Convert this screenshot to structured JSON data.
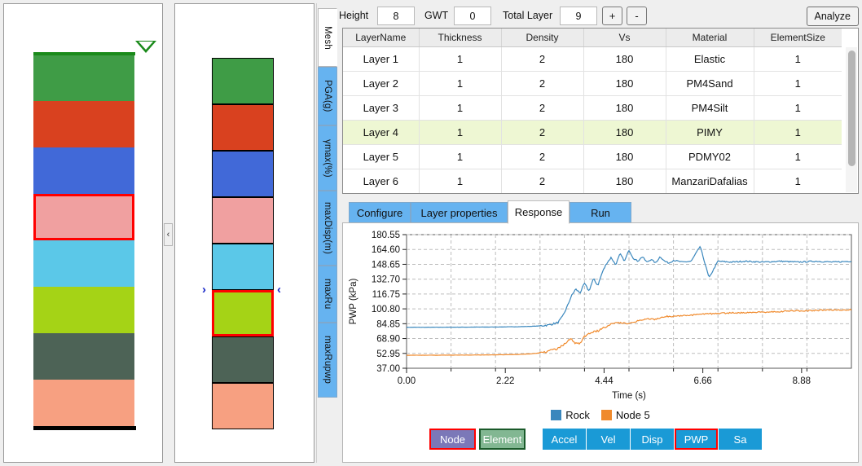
{
  "toolbar": {
    "height_label": "Height",
    "height_value": "8",
    "gwt_label": "GWT",
    "gwt_value": "0",
    "total_layer_label": "Total Layer",
    "total_layer_value": "9",
    "plus_label": "+",
    "minus_label": "-",
    "analyze_label": "Analyze"
  },
  "vertical_tabs": [
    {
      "label": "Mesh",
      "active": true
    },
    {
      "label": "PGA(g)",
      "active": false
    },
    {
      "label": "γmax(%)",
      "active": false
    },
    {
      "label": "maxDisp(m)",
      "active": false
    },
    {
      "label": "maxRu",
      "active": false
    },
    {
      "label": "maxRupwp",
      "active": false
    }
  ],
  "table": {
    "columns": [
      "LayerName",
      "Thickness",
      "Density",
      "Vs",
      "Material",
      "ElementSize"
    ],
    "rows": [
      {
        "cells": [
          "Layer 1",
          "1",
          "2",
          "180",
          "Elastic",
          "1"
        ],
        "selected": false
      },
      {
        "cells": [
          "Layer 2",
          "1",
          "2",
          "180",
          "PM4Sand",
          "1"
        ],
        "selected": false
      },
      {
        "cells": [
          "Layer 3",
          "1",
          "2",
          "180",
          "PM4Silt",
          "1"
        ],
        "selected": false
      },
      {
        "cells": [
          "Layer 4",
          "1",
          "2",
          "180",
          "PIMY",
          "1"
        ],
        "selected": true
      },
      {
        "cells": [
          "Layer 5",
          "1",
          "2",
          "180",
          "PDMY02",
          "1"
        ],
        "selected": false
      },
      {
        "cells": [
          "Layer 6",
          "1",
          "2",
          "180",
          "ManzariDafalias",
          "1"
        ],
        "selected": false
      }
    ]
  },
  "bottom_tabs": [
    {
      "label": "Configure",
      "active": false
    },
    {
      "label": "Layer properties",
      "active": false
    },
    {
      "label": "Response",
      "active": true
    },
    {
      "label": "Run",
      "active": false
    }
  ],
  "selector_buttons": [
    {
      "label": "Node",
      "style": "node"
    },
    {
      "label": "Element",
      "style": "elem"
    }
  ],
  "response_buttons": [
    {
      "label": "Accel",
      "selected": false
    },
    {
      "label": "Vel",
      "selected": false
    },
    {
      "label": "Disp",
      "selected": false
    },
    {
      "label": "PWP",
      "selected": true
    },
    {
      "label": "Sa",
      "selected": false
    }
  ],
  "profile": {
    "water_table_icon": "water-table-triangle",
    "left_layers": [
      {
        "color": "#3f9c46",
        "selected": false
      },
      {
        "color": "#d9411f",
        "selected": false
      },
      {
        "color": "#4169d8",
        "selected": false
      },
      {
        "color": "#f0a0a0",
        "selected": true
      },
      {
        "color": "#5bc8e8",
        "selected": false
      },
      {
        "color": "#a5d316",
        "selected": false
      },
      {
        "color": "#4d6356",
        "selected": false
      },
      {
        "color": "#f7a081",
        "selected": false
      }
    ],
    "mid_layers": [
      {
        "color": "#3f9c46",
        "selected": false
      },
      {
        "color": "#d9411f",
        "selected": false
      },
      {
        "color": "#4169d8",
        "selected": false
      },
      {
        "color": "#f0a0a0",
        "selected": false
      },
      {
        "color": "#5bc8e8",
        "selected": false
      },
      {
        "color": "#a5d316",
        "selected": true
      },
      {
        "color": "#4d6356",
        "selected": false
      },
      {
        "color": "#f7a081",
        "selected": false
      }
    ],
    "collapse_handle_label": "‹",
    "left_marker": "›",
    "right_marker": "‹"
  },
  "chart_data": {
    "type": "line",
    "title": "",
    "xlabel": "Time (s)",
    "ylabel": "PWP (kPa)",
    "xlim": [
      0.0,
      10.0
    ],
    "ylim": [
      37.0,
      180.55
    ],
    "xticks": [
      "0.00",
      "2.22",
      "4.44",
      "6.66",
      "8.88"
    ],
    "xtick_values": [
      0.0,
      2.22,
      4.44,
      6.66,
      8.88
    ],
    "yticks": [
      "37.00",
      "52.95",
      "68.90",
      "84.85",
      "100.80",
      "116.75",
      "132.70",
      "148.65",
      "164.60",
      "180.55"
    ],
    "ytick_values": [
      37.0,
      52.95,
      68.9,
      84.85,
      100.8,
      116.75,
      132.7,
      148.65,
      164.6,
      180.55
    ],
    "grid": true,
    "legend_position": "bottom",
    "series": [
      {
        "name": "Rock",
        "color": "#3a87bd",
        "x": [
          0.0,
          0.5,
          1.0,
          1.5,
          2.0,
          2.5,
          2.8,
          3.0,
          3.2,
          3.4,
          3.5,
          3.6,
          3.7,
          3.8,
          3.9,
          4.0,
          4.1,
          4.2,
          4.3,
          4.4,
          4.5,
          4.6,
          4.7,
          4.8,
          4.9,
          5.0,
          5.1,
          5.2,
          5.3,
          5.4,
          5.5,
          5.6,
          5.7,
          5.8,
          5.9,
          6.0,
          6.2,
          6.4,
          6.6,
          6.8,
          7.0,
          7.3,
          7.6,
          8.0,
          8.4,
          8.8,
          9.2,
          9.6,
          10.0
        ],
        "y": [
          81.0,
          81.0,
          81.1,
          81.2,
          81.3,
          81.6,
          82.0,
          82.5,
          83.5,
          86.0,
          92.0,
          102.0,
          114.0,
          122.0,
          118.0,
          128.0,
          120.0,
          133.0,
          126.0,
          140.0,
          150.0,
          156.0,
          148.0,
          160.0,
          152.0,
          164.0,
          155.0,
          152.0,
          157.0,
          151.0,
          154.0,
          150.0,
          157.0,
          152.0,
          150.0,
          153.0,
          151.0,
          152.0,
          168.0,
          134.0,
          152.0,
          151.0,
          152.0,
          151.0,
          152.0,
          151.0,
          152.0,
          151.0,
          152.0
        ]
      },
      {
        "name": "Node 5",
        "color": "#f08a2c",
        "x": [
          0.0,
          0.5,
          1.0,
          1.5,
          2.0,
          2.5,
          2.8,
          3.0,
          3.2,
          3.4,
          3.6,
          3.7,
          3.8,
          3.9,
          4.0,
          4.1,
          4.2,
          4.3,
          4.4,
          4.5,
          4.6,
          4.8,
          5.0,
          5.2,
          5.4,
          5.6,
          5.8,
          6.0,
          6.2,
          6.4,
          6.6,
          6.8,
          7.0,
          7.4,
          7.8,
          8.2,
          8.6,
          9.0,
          9.4,
          10.0
        ],
        "y": [
          51.0,
          51.0,
          51.1,
          51.2,
          51.4,
          51.8,
          52.5,
          53.5,
          55.5,
          58.0,
          65.0,
          69.0,
          63.5,
          64.0,
          71.0,
          74.0,
          76.5,
          77.0,
          80.5,
          82.0,
          85.5,
          86.0,
          85.0,
          88.0,
          90.0,
          89.5,
          92.5,
          93.0,
          93.5,
          94.0,
          95.0,
          95.5,
          96.0,
          96.5,
          97.0,
          97.5,
          98.5,
          98.8,
          99.5,
          99.8
        ]
      }
    ]
  }
}
